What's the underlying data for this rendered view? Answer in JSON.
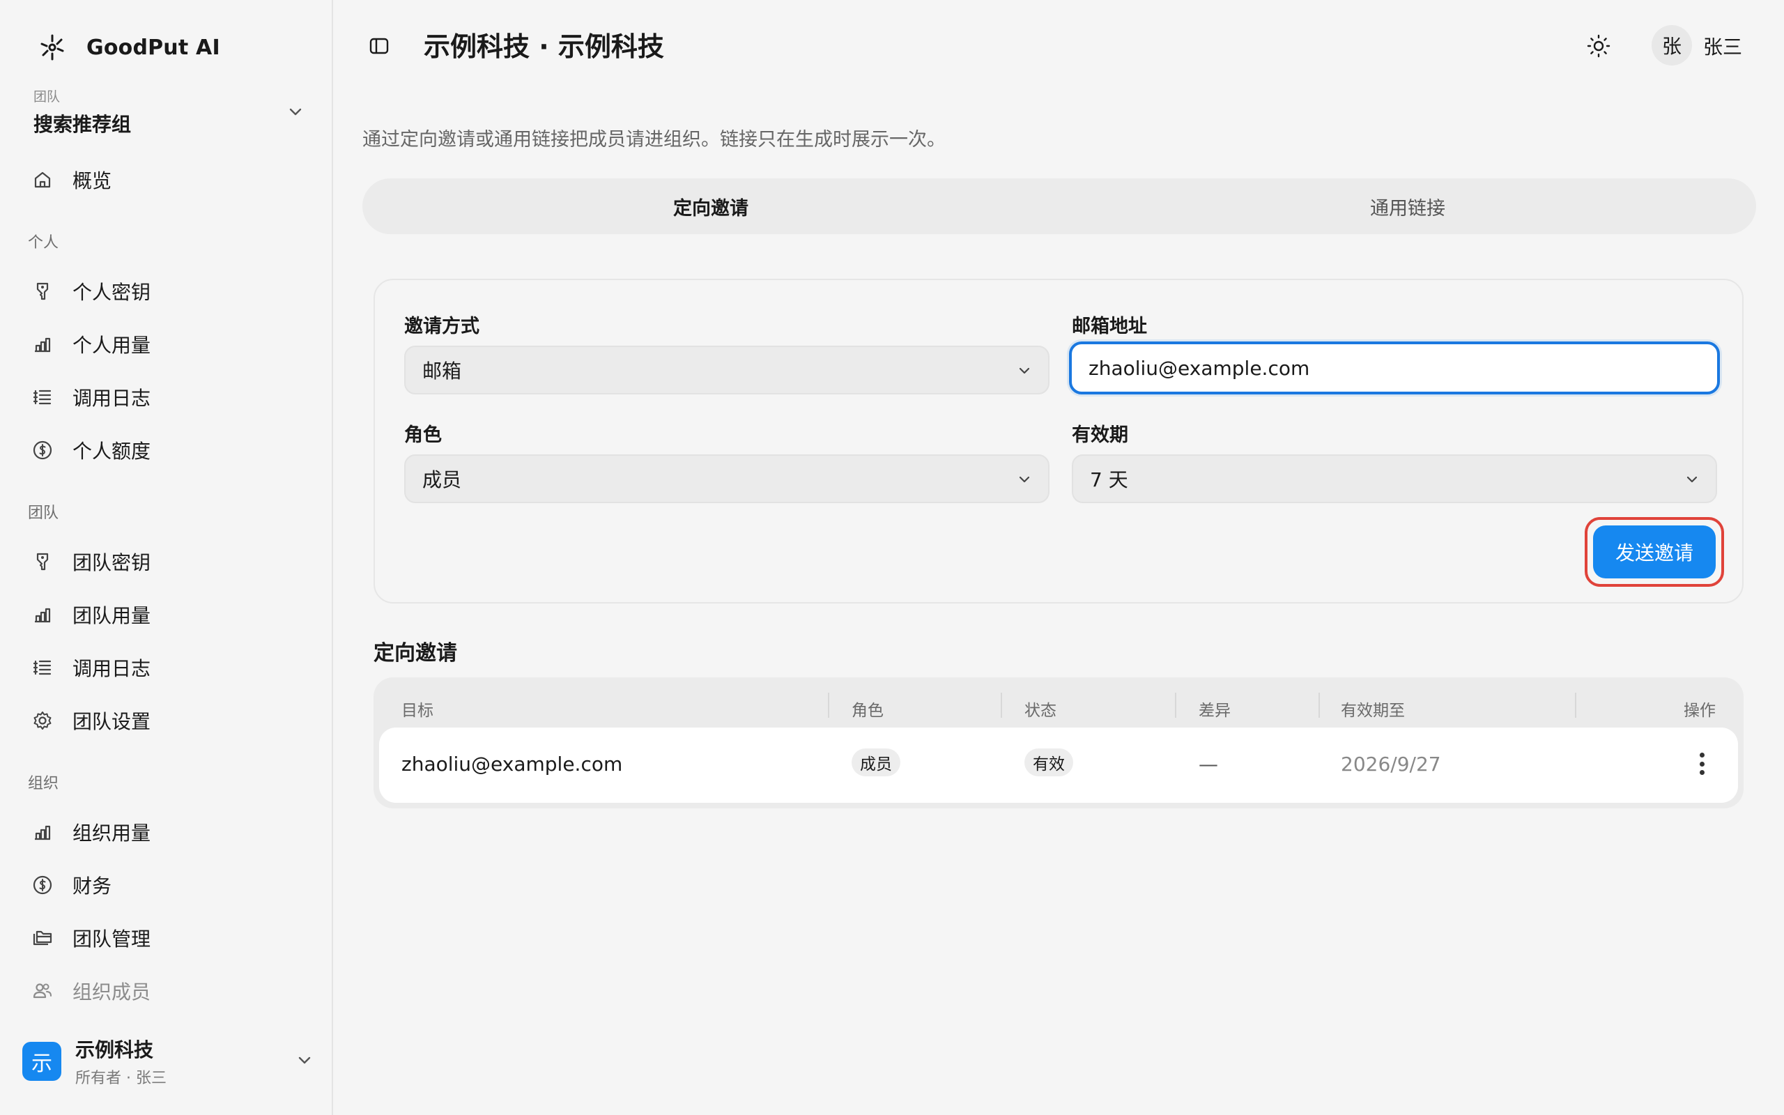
{
  "brand": {
    "name": "GoodPut AI"
  },
  "team_switch": {
    "caption": "团队",
    "name": "搜索推荐组"
  },
  "nav": {
    "overview": "概览",
    "section_personal": "个人",
    "personal_keys": "个人密钥",
    "personal_usage": "个人用量",
    "call_logs": "调用日志",
    "personal_quota": "个人额度",
    "section_team": "团队",
    "team_keys": "团队密钥",
    "team_usage": "团队用量",
    "team_call_logs": "调用日志",
    "team_settings": "团队设置",
    "section_org": "组织",
    "org_usage": "组织用量",
    "finance": "财务",
    "team_management": "团队管理",
    "org_members": "组织成员"
  },
  "org_switch": {
    "avatar": "示",
    "name": "示例科技",
    "sub": "所有者 · 张三"
  },
  "header": {
    "title": "示例科技 · 示例科技",
    "user_avatar": "张",
    "user_name": "张三"
  },
  "description": "通过定向邀请或通用链接把成员请进组织。链接只在生成时展示一次。",
  "tabs": {
    "targeted": "定向邀请",
    "general": "通用链接"
  },
  "form": {
    "method_label": "邀请方式",
    "method_value": "邮箱",
    "email_label": "邮箱地址",
    "email_value": "zhaoliu@example.com",
    "role_label": "角色",
    "role_value": "成员",
    "expiry_label": "有效期",
    "expiry_value": "7 天",
    "send_label": "发送邀请"
  },
  "invites": {
    "title": "定向邀请",
    "headers": [
      "目标",
      "角色",
      "状态",
      "差异",
      "有效期至",
      "操作"
    ],
    "rows": [
      {
        "target": "zhaoliu@example.com",
        "role": "成员",
        "status": "有效",
        "diff": "—",
        "expires": "2026/9/27"
      }
    ]
  },
  "colors": {
    "accent": "#1688f0",
    "focus_ring": "#1a78e0",
    "highlight": "#e0433a"
  }
}
